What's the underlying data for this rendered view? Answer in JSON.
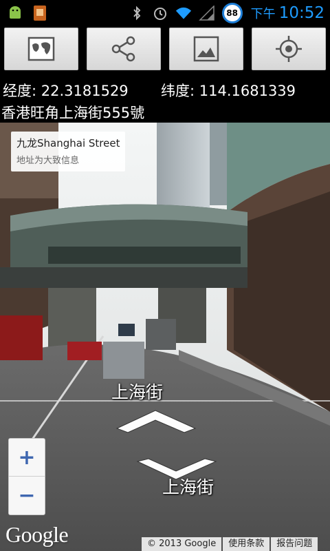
{
  "status_bar": {
    "battery_level": "88",
    "clock_ampm": "下午",
    "clock_time": "10:52"
  },
  "toolbar": {
    "buttons": [
      {
        "icon": "map-icon"
      },
      {
        "icon": "share-icon"
      },
      {
        "icon": "image-icon"
      },
      {
        "icon": "locate-icon"
      }
    ]
  },
  "location": {
    "latitude_label": "经度: 22.3181529",
    "longitude_label": "纬度: 114.1681339",
    "address": "香港旺角上海街555號"
  },
  "street_view": {
    "card_title": "九龙Shanghai Street",
    "card_subtitle": "地址为大致信息",
    "street_label_upper": "上海街",
    "street_label_lower": "上海街",
    "zoom_in": "+",
    "zoom_out": "−",
    "logo": "Google",
    "footer": {
      "copyright": "© 2013 Google",
      "terms": "使用条款",
      "report": "报告问题"
    }
  },
  "colors": {
    "accent": "#1e9cff",
    "zoom_blue": "#3f67b0"
  }
}
